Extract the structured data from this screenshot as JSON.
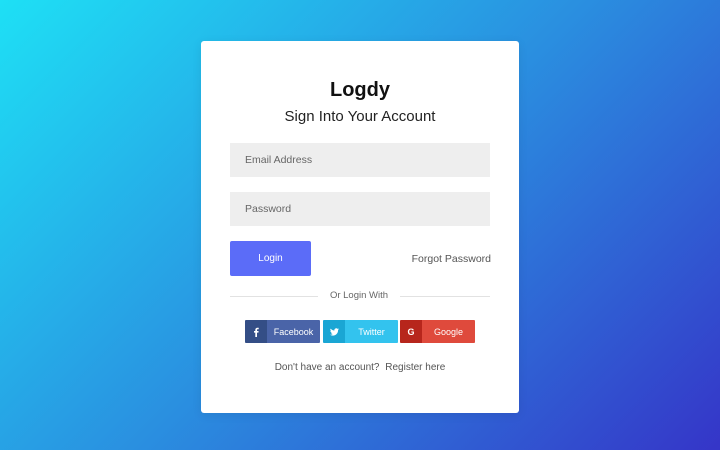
{
  "colors": {
    "background_gradient_start": "#1ee0f5",
    "background_gradient_end": "#3535c8",
    "login_button": "#5b6cf8",
    "facebook": "#4a64a8",
    "twitter": "#33c3ee",
    "google": "#df4a3c"
  },
  "card": {
    "brand": "Logdy",
    "subtitle": "Sign Into Your Account"
  },
  "form": {
    "email_placeholder": "Email Address",
    "email_value": "",
    "password_placeholder": "Password",
    "password_value": "",
    "login_label": "Login",
    "forgot_label": "Forgot Password"
  },
  "divider": {
    "text": "Or Login With"
  },
  "social": {
    "facebook": {
      "label": "Facebook",
      "icon": "facebook-icon",
      "glyph": "f"
    },
    "twitter": {
      "label": "Twitter",
      "icon": "twitter-icon",
      "glyph": "❧"
    },
    "google": {
      "label": "Google",
      "icon": "google-icon",
      "glyph": "G"
    }
  },
  "footer": {
    "prompt": "Don't have an account?",
    "register_label": "Register here"
  }
}
